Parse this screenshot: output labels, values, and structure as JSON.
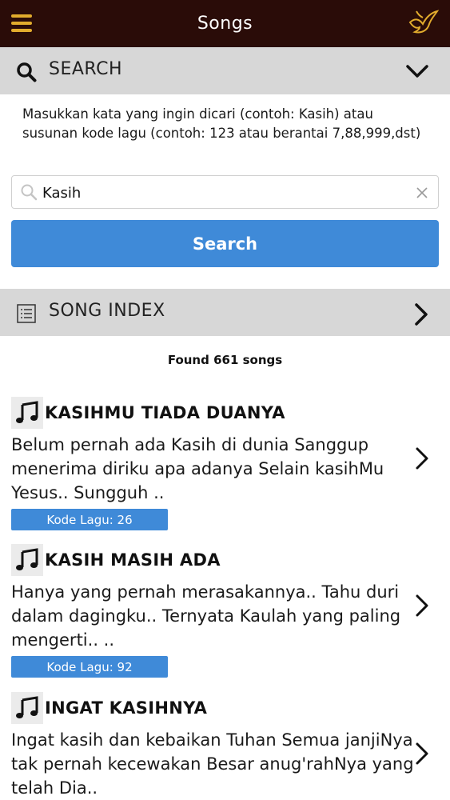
{
  "app": {
    "title": "Songs"
  },
  "search": {
    "header": "SEARCH",
    "hint": "Masukkan kata yang ingin dicari (contoh: Kasih) atau susunan kode lagu (contoh: 123 atau berantai 7,88,999,dst)",
    "value": "Kasih",
    "button_label": "Search"
  },
  "index": {
    "header": "SONG INDEX"
  },
  "results": {
    "count_text": "Found 661 songs",
    "songs": [
      {
        "title": "KASIHMU TIADA DUANYA",
        "lyrics": "Belum pernah ada Kasih di dunia Sanggup menerima diriku apa adanya Selain kasihMu Yesus.. Sungguh ..",
        "code": "Kode Lagu: 26"
      },
      {
        "title": "KASIH MASIH ADA",
        "lyrics": "Hanya yang pernah merasakannya.. Tahu duri dalam dagingku.. Ternyata Kaulah yang paling mengerti.. ..",
        "code": "Kode Lagu: 92"
      },
      {
        "title": "INGAT KASIHNYA",
        "lyrics": "Ingat kasih dan kebaikan Tuhan Semua janjiNya tak pernah kecewakan Besar anug'rahNya yang telah Dia..",
        "code": ""
      }
    ]
  },
  "icons": {
    "menu": "hamburger-menu-icon",
    "logo": "dove-logo-icon",
    "search": "search-icon",
    "collapse": "chevron-down-icon",
    "index": "list-icon",
    "row": "chevron-right-icon",
    "song": "music-note-icon",
    "clear": "clear-icon"
  },
  "colors": {
    "topbar": "#2a0c08",
    "accent_gold": "#e2ac2d",
    "button_blue": "#3f8ad8",
    "section_gray": "#d7d7d7"
  }
}
